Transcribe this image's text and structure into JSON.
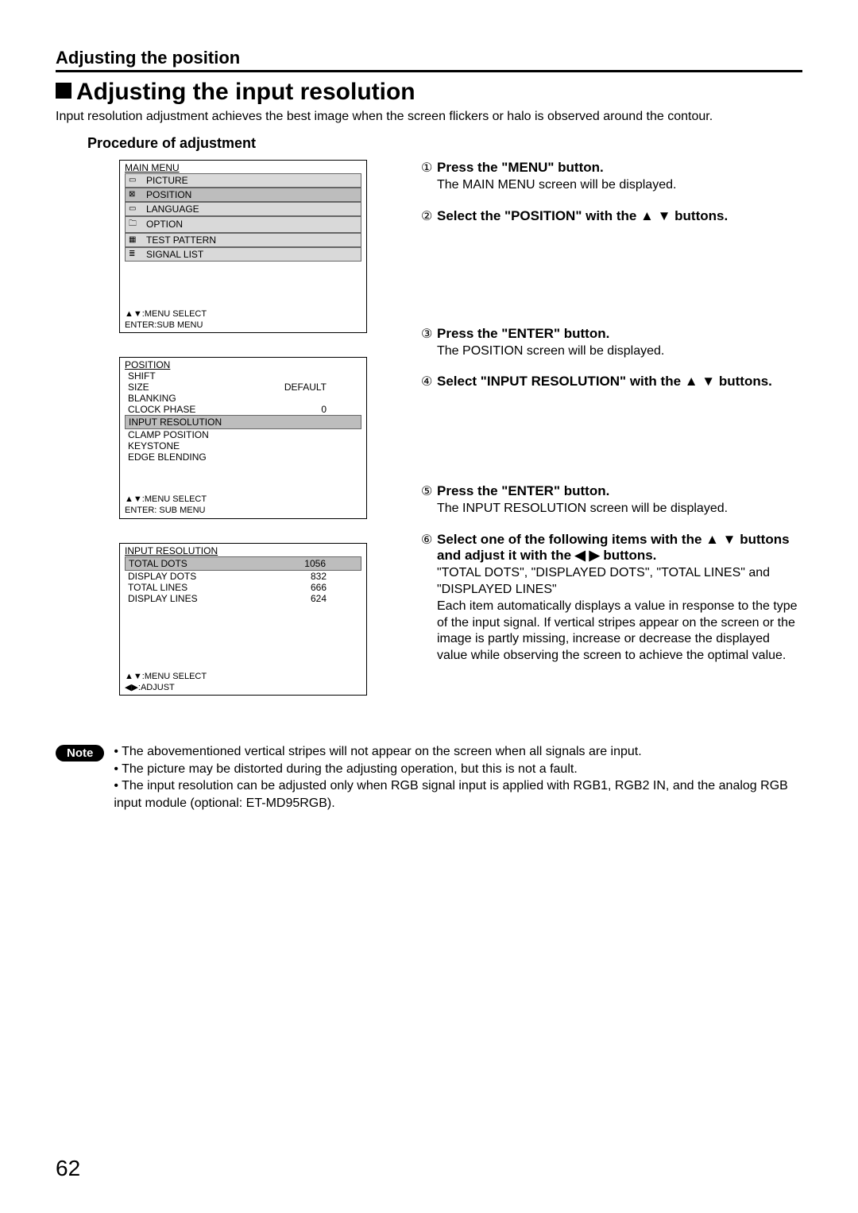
{
  "header": "Adjusting the position",
  "title": "Adjusting the input resolution",
  "intro": "Input resolution adjustment achieves the best image when the screen flickers or halo is observed around the contour.",
  "subheading": "Procedure of adjustment",
  "menu1": {
    "title": "MAIN MENU",
    "items": [
      "PICTURE",
      "POSITION",
      "LANGUAGE",
      "OPTION",
      "TEST PATTERN",
      "SIGNAL LIST"
    ],
    "footer1": "▲▼:MENU SELECT",
    "footer2": "ENTER:SUB MENU"
  },
  "menu2": {
    "title": "POSITION",
    "rows": [
      {
        "label": "SHIFT",
        "val": ""
      },
      {
        "label": "SIZE",
        "val": "DEFAULT"
      },
      {
        "label": "BLANKING",
        "val": ""
      },
      {
        "label": "CLOCK PHASE",
        "val": "0"
      },
      {
        "label": "INPUT RESOLUTION",
        "val": ""
      },
      {
        "label": "CLAMP POSITION",
        "val": ""
      },
      {
        "label": "KEYSTONE",
        "val": ""
      },
      {
        "label": "EDGE BLENDING",
        "val": ""
      }
    ],
    "footer1": "▲▼:MENU SELECT",
    "footer2": "ENTER: SUB MENU"
  },
  "menu3": {
    "title": "INPUT RESOLUTION",
    "rows": [
      {
        "label": "TOTAL DOTS",
        "val": "1056"
      },
      {
        "label": "DISPLAY DOTS",
        "val": "832"
      },
      {
        "label": "TOTAL LINES",
        "val": "666"
      },
      {
        "label": "DISPLAY LINES",
        "val": "624"
      }
    ],
    "footer1": "▲▼:MENU SELECT",
    "footer2": "◀▶:ADJUST"
  },
  "steps": {
    "s1": {
      "num": "①",
      "title": "Press the \"MENU\" button.",
      "body": "The MAIN MENU screen will be displayed."
    },
    "s2": {
      "num": "②",
      "title": "Select the \"POSITION\" with the ▲ ▼ buttons."
    },
    "s3": {
      "num": "③",
      "title": "Press the \"ENTER\" button.",
      "body": "The POSITION screen will be displayed."
    },
    "s4": {
      "num": "④",
      "title": "Select \"INPUT RESOLUTION\" with the ▲ ▼ buttons."
    },
    "s5": {
      "num": "⑤",
      "title": "Press the \"ENTER\" button.",
      "body": "The INPUT RESOLUTION screen will be displayed."
    },
    "s6": {
      "num": "⑥",
      "title": "Select one of the following items with the ▲ ▼ buttons and adjust it with the ◀ ▶ buttons.",
      "body1": "\"TOTAL DOTS\", \"DISPLAYED DOTS\", \"TOTAL LINES\" and \"DISPLAYED LINES\"",
      "body2": "Each item automatically displays a value in response to the type of the input signal. If vertical stripes appear on the screen or the image is partly missing, increase or decrease the displayed value while observing the screen to achieve the optimal value."
    }
  },
  "note": {
    "label": "Note",
    "items": [
      "• The abovementioned vertical stripes will not appear on the screen when all signals are input.",
      "• The picture may be distorted during the adjusting operation, but this is not a fault.",
      "• The input resolution can be adjusted only when RGB signal input is applied with RGB1, RGB2 IN, and the analog RGB input module (optional: ET-MD95RGB)."
    ]
  },
  "page_number": "62"
}
